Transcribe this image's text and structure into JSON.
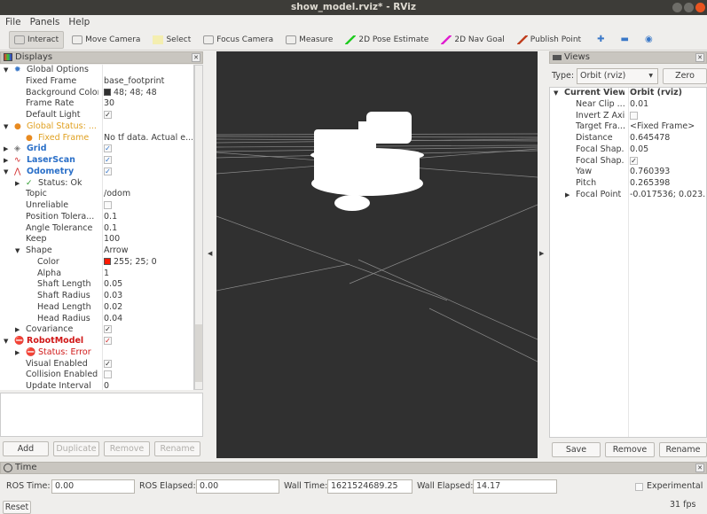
{
  "window": {
    "title": "show_model.rviz* - RViz"
  },
  "menu": [
    "File",
    "Panels",
    "Help"
  ],
  "toolbar": [
    {
      "label": "Interact",
      "icon": "hand-icon",
      "active": true
    },
    {
      "label": "Move Camera",
      "icon": "move-camera-icon"
    },
    {
      "label": "Select",
      "icon": "select-icon"
    },
    {
      "label": "Focus Camera",
      "icon": "focus-camera-icon"
    },
    {
      "label": "Measure",
      "icon": "ruler-icon"
    },
    {
      "label": "2D Pose Estimate",
      "icon": "pose-estimate-icon",
      "color": "#22cc22"
    },
    {
      "label": "2D Nav Goal",
      "icon": "nav-goal-icon",
      "color": "#e020d0"
    },
    {
      "label": "Publish Point",
      "icon": "map-pin-icon",
      "color": "#c04020"
    }
  ],
  "displays": {
    "title": "Displays",
    "rows": [
      {
        "l": 0,
        "k": "Global Options",
        "exp": "down",
        "icon": "gear-icon"
      },
      {
        "l": 1,
        "k": "Fixed Frame",
        "v": "base_footprint"
      },
      {
        "l": 1,
        "k": "Background Color",
        "v": "48; 48; 48",
        "swatch": "#303030"
      },
      {
        "l": 1,
        "k": "Frame Rate",
        "v": "30"
      },
      {
        "l": 1,
        "k": "Default Light",
        "cb": true
      },
      {
        "l": 0,
        "k": "Global Status: ...",
        "exp": "down",
        "icon": "warning-icon",
        "cls": "warn"
      },
      {
        "l": 1,
        "k": "Fixed Frame",
        "v": "No tf data.  Actual e...",
        "icon": "warning-icon",
        "cls": "warn"
      },
      {
        "l": 0,
        "k": "Grid",
        "exp": "right",
        "icon": "grid-icon",
        "cls": "blue",
        "cb": true
      },
      {
        "l": 0,
        "k": "LaserScan",
        "exp": "right",
        "icon": "laserscan-icon",
        "cls": "blue",
        "cb": true
      },
      {
        "l": 0,
        "k": "Odometry",
        "exp": "down",
        "icon": "odometry-icon",
        "cls": "blue",
        "cb": true
      },
      {
        "l": 1,
        "k": "Status: Ok",
        "exp": "right",
        "icon": "check-icon"
      },
      {
        "l": 1,
        "k": "Topic",
        "v": "/odom"
      },
      {
        "l": 1,
        "k": "Unreliable",
        "cb": false
      },
      {
        "l": 1,
        "k": "Position Tolera...",
        "v": "0.1"
      },
      {
        "l": 1,
        "k": "Angle Tolerance",
        "v": "0.1"
      },
      {
        "l": 1,
        "k": "Keep",
        "v": "100"
      },
      {
        "l": 1,
        "k": "Shape",
        "v": "Arrow",
        "exp": "down"
      },
      {
        "l": 2,
        "k": "Color",
        "v": "255; 25; 0",
        "swatch": "#ff1900"
      },
      {
        "l": 2,
        "k": "Alpha",
        "v": "1"
      },
      {
        "l": 2,
        "k": "Shaft Length",
        "v": "0.05"
      },
      {
        "l": 2,
        "k": "Shaft Radius",
        "v": "0.03"
      },
      {
        "l": 2,
        "k": "Head Length",
        "v": "0.02"
      },
      {
        "l": 2,
        "k": "Head Radius",
        "v": "0.04"
      },
      {
        "l": 1,
        "k": "Covariance",
        "exp": "right",
        "cb": true
      },
      {
        "l": 0,
        "k": "RobotModel",
        "exp": "down",
        "icon": "error-icon",
        "cls": "err",
        "cb": true
      },
      {
        "l": 1,
        "k": "Status: Error",
        "exp": "right",
        "icon": "error-icon",
        "cls": "err"
      },
      {
        "l": 1,
        "k": "Visual Enabled",
        "cb": true
      },
      {
        "l": 1,
        "k": "Collision Enabled",
        "cb": false
      },
      {
        "l": 1,
        "k": "Update Interval",
        "v": "0"
      }
    ],
    "buttons": {
      "add": "Add",
      "duplicate": "Duplicate",
      "remove": "Remove",
      "rename": "Rename"
    }
  },
  "views": {
    "title": "Views",
    "type_label": "Type:",
    "type_value": "Orbit (rviz)",
    "zero": "Zero",
    "rows": [
      {
        "l": 0,
        "k": "Current View",
        "v": "Orbit (rviz)",
        "exp": "down",
        "bold": true
      },
      {
        "l": 1,
        "k": "Near Clip ...",
        "v": "0.01"
      },
      {
        "l": 1,
        "k": "Invert Z Axis",
        "cb": false
      },
      {
        "l": 1,
        "k": "Target Fra...",
        "v": "<Fixed Frame>"
      },
      {
        "l": 1,
        "k": "Distance",
        "v": "0.645478"
      },
      {
        "l": 1,
        "k": "Focal Shap...",
        "v": "0.05"
      },
      {
        "l": 1,
        "k": "Focal Shap...",
        "cb": true
      },
      {
        "l": 1,
        "k": "Yaw",
        "v": "0.760393"
      },
      {
        "l": 1,
        "k": "Pitch",
        "v": "0.265398"
      },
      {
        "l": 1,
        "k": "Focal Point",
        "v": "-0.017536; 0.023...",
        "exp": "right"
      }
    ],
    "buttons": {
      "save": "Save",
      "remove": "Remove",
      "rename": "Rename"
    }
  },
  "time": {
    "title": "Time",
    "ros_time_label": "ROS Time:",
    "ros_time": "0.00",
    "ros_elapsed_label": "ROS Elapsed:",
    "ros_elapsed": "0.00",
    "wall_time_label": "Wall Time:",
    "wall_time": "1621524689.25",
    "wall_elapsed_label": "Wall Elapsed:",
    "wall_elapsed": "14.17",
    "experimental": "Experimental",
    "experimental_checked": false,
    "reset": "Reset",
    "fps": "31 fps"
  },
  "colors": {
    "background": "#303030",
    "warn": "#e0a020",
    "blue": "#2a6fc8",
    "err": "#d01818"
  }
}
